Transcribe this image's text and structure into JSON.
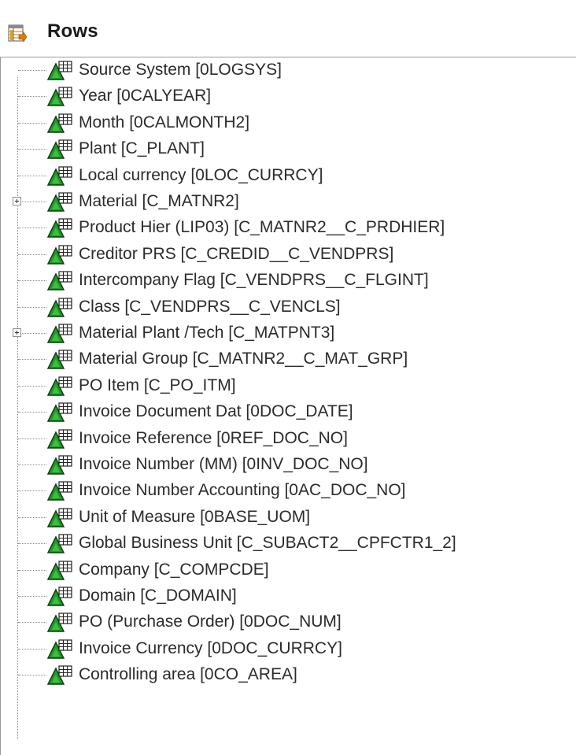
{
  "header": {
    "title": "Rows",
    "icon": "table-arrow-icon"
  },
  "tree": {
    "item_icon": "dimension-characteristic-icon",
    "items": [
      {
        "label": "Source System [0LOGSYS]",
        "expandable": false
      },
      {
        "label": "Year [0CALYEAR]",
        "expandable": false
      },
      {
        "label": "Month [0CALMONTH2]",
        "expandable": false
      },
      {
        "label": "Plant [C_PLANT]",
        "expandable": false
      },
      {
        "label": "Local currency [0LOC_CURRCY]",
        "expandable": false
      },
      {
        "label": "Material [C_MATNR2]",
        "expandable": true
      },
      {
        "label": "Product Hier (LIP03) [C_MATNR2__C_PRDHIER]",
        "expandable": false
      },
      {
        "label": "Creditor PRS [C_CREDID__C_VENDPRS]",
        "expandable": false
      },
      {
        "label": "Intercompany Flag [C_VENDPRS__C_FLGINT]",
        "expandable": false
      },
      {
        "label": "Class [C_VENDPRS__C_VENCLS]",
        "expandable": false
      },
      {
        "label": "Material Plant /Tech [C_MATPNT3]",
        "expandable": true
      },
      {
        "label": "Material Group [C_MATNR2__C_MAT_GRP]",
        "expandable": false
      },
      {
        "label": "PO Item [C_PO_ITM]",
        "expandable": false
      },
      {
        "label": "Invoice Document Dat [0DOC_DATE]",
        "expandable": false
      },
      {
        "label": "Invoice Reference [0REF_DOC_NO]",
        "expandable": false
      },
      {
        "label": "Invoice Number (MM) [0INV_DOC_NO]",
        "expandable": false
      },
      {
        "label": "Invoice Number Accounting [0AC_DOC_NO]",
        "expandable": false
      },
      {
        "label": "Unit of Measure [0BASE_UOM]",
        "expandable": false
      },
      {
        "label": "Global Business Unit [C_SUBACT2__CPFCTR1_2]",
        "expandable": false
      },
      {
        "label": "Company [C_COMPCDE]",
        "expandable": false
      },
      {
        "label": "Domain [C_DOMAIN]",
        "expandable": false
      },
      {
        "label": "PO (Purchase Order) [0DOC_NUM]",
        "expandable": false
      },
      {
        "label": "Invoice Currency [0DOC_CURRCY]",
        "expandable": false
      },
      {
        "label": "Controlling area [0CO_AREA]",
        "expandable": false
      }
    ]
  }
}
